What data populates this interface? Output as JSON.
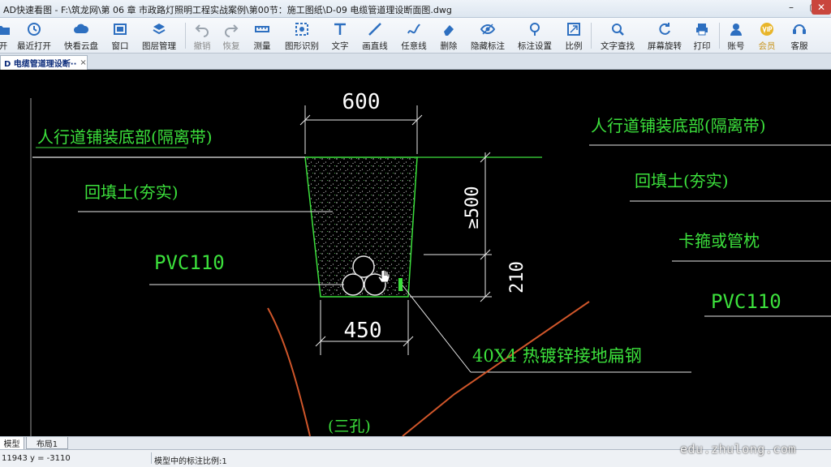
{
  "window": {
    "title": "AD快速看图 - F:\\筑龙网\\第 06 章 市政路灯照明工程实战案例\\第00节：施工图纸\\D-09 电缆管道理设断面图.dwg",
    "min": "–",
    "max": "▢",
    "close": "✕"
  },
  "toolbar": {
    "items": [
      {
        "label": "开",
        "icon": "open-icon"
      },
      {
        "label": "最近打开",
        "icon": "recent-icon"
      },
      {
        "label": "快看云盘",
        "icon": "cloud-icon"
      },
      {
        "label": "窗口",
        "icon": "window-icon"
      },
      {
        "label": "图层管理",
        "icon": "layers-icon"
      },
      {
        "label": "撤销",
        "icon": "undo-icon",
        "disabled": true
      },
      {
        "label": "恢复",
        "icon": "redo-icon",
        "disabled": true
      },
      {
        "label": "测量",
        "icon": "measure-icon"
      },
      {
        "label": "图形识别",
        "icon": "recognize-icon"
      },
      {
        "label": "文字",
        "icon": "text-icon"
      },
      {
        "label": "画直线",
        "icon": "line-icon"
      },
      {
        "label": "任意线",
        "icon": "freehand-icon"
      },
      {
        "label": "删除",
        "icon": "eraser-icon"
      },
      {
        "label": "隐藏标注",
        "icon": "eye-icon"
      },
      {
        "label": "标注设置",
        "icon": "annotation-settings-icon"
      },
      {
        "label": "比例",
        "icon": "scale-icon"
      },
      {
        "label": "文字查找",
        "icon": "text-search-icon"
      },
      {
        "label": "屏幕旋转",
        "icon": "rotate-icon"
      },
      {
        "label": "打印",
        "icon": "print-icon"
      },
      {
        "label": "账号",
        "icon": "account-icon"
      },
      {
        "label": "会员",
        "icon": "vip-icon"
      },
      {
        "label": "客服",
        "icon": "support-icon"
      }
    ]
  },
  "tabs": {
    "document": "D 电缆管道理设断··",
    "close": "×"
  },
  "drawing": {
    "dim_top": "600",
    "dim_bottom": "450",
    "dim_depth": "≥500",
    "dim_pipe": "210",
    "left_labels": {
      "paving": "人行道铺装底部(隔离带)",
      "backfill": "回填土(夯实)",
      "pvc": "PVC110"
    },
    "right_labels": {
      "paving": "人行道铺装底部(隔离带)",
      "backfill": "回填土(夯实)",
      "clamp": "卡箍或管枕",
      "pvc": "PVC110"
    },
    "ground_steel": "40X4 热镀锌接地扁钢",
    "three_holes": "(三孔)",
    "colors": {
      "white": "#ffffff",
      "green": "#3ce03c",
      "orange": "#d0562a",
      "gray": "#c0c0c0"
    }
  },
  "layout_tabs": {
    "model": "模型",
    "layout1": "布局1"
  },
  "status": {
    "coords": "11943 y = -3110",
    "scale": "模型中的标注比例:1"
  },
  "watermark": "edu.zhulong.com"
}
